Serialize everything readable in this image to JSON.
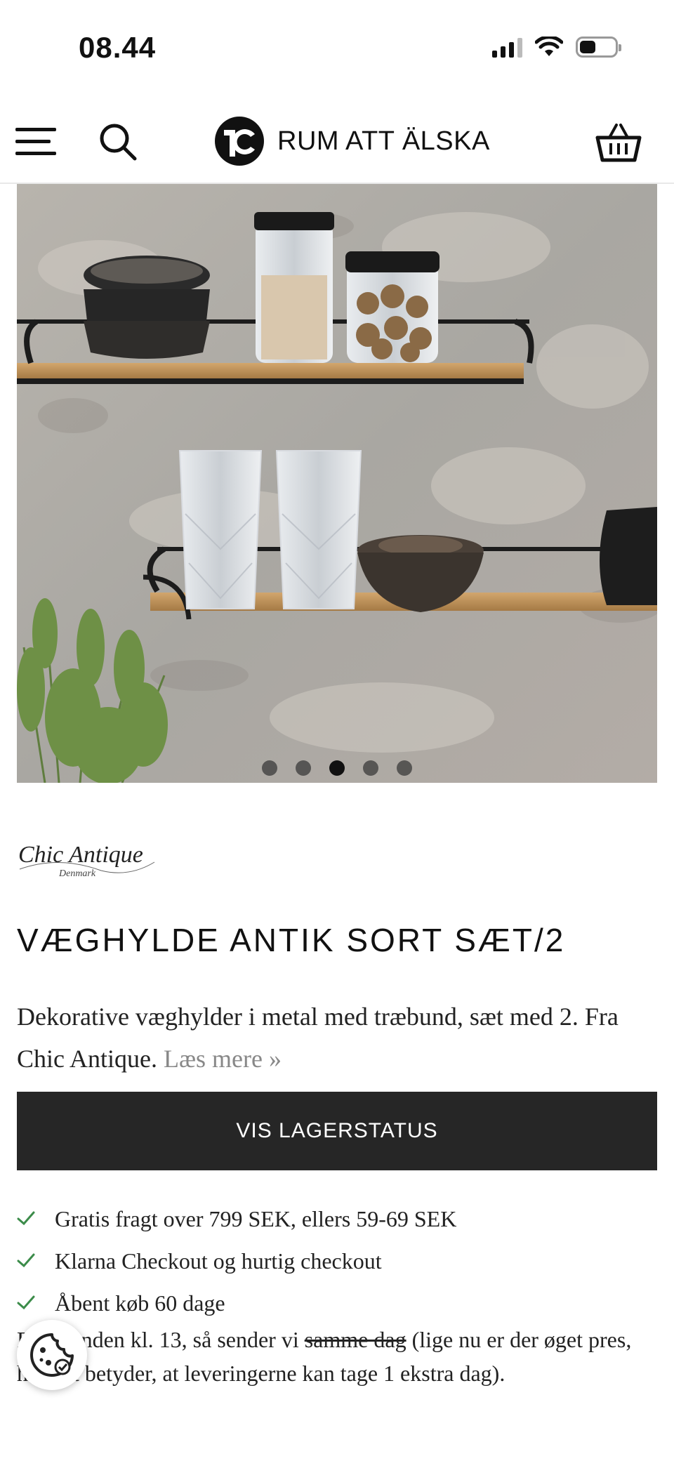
{
  "status_bar": {
    "time": "08.44"
  },
  "header": {
    "brand_name": "RUM ATT ÄLSKA",
    "icons": [
      "menu-icon",
      "search-icon",
      "brand-logo-mark",
      "cart-icon"
    ]
  },
  "gallery": {
    "slide_count": 5,
    "active_slide": 3
  },
  "product": {
    "brand_logo_text": "Chic Antique",
    "brand_logo_subtext": "Denmark",
    "title": "VÆGHYLDE ANTIK SORT SÆT/2",
    "description": "Dekorative væghylder i metal med træbund, sæt med 2. Fra Chic Antique.",
    "read_more": "Læs mere »",
    "stock_button": "VIS LAGERSTATUS"
  },
  "usps": [
    "Gratis fragt over 799 SEK, ellers 59-69 SEK",
    "Klarna Checkout og hurtig checkout",
    "Åbent køb 60 dage"
  ],
  "shipping_note": {
    "part1": "Bestil inden kl. 13, så sender vi",
    "struck": "samme dag",
    "part2": "(lige nu er der øget pres, hvilket betyder, at leveringerne kan tage 1 ekstra dag)."
  },
  "colors": {
    "button_bg": "#262626",
    "check_green": "#3c8c4a",
    "text": "#222222"
  }
}
